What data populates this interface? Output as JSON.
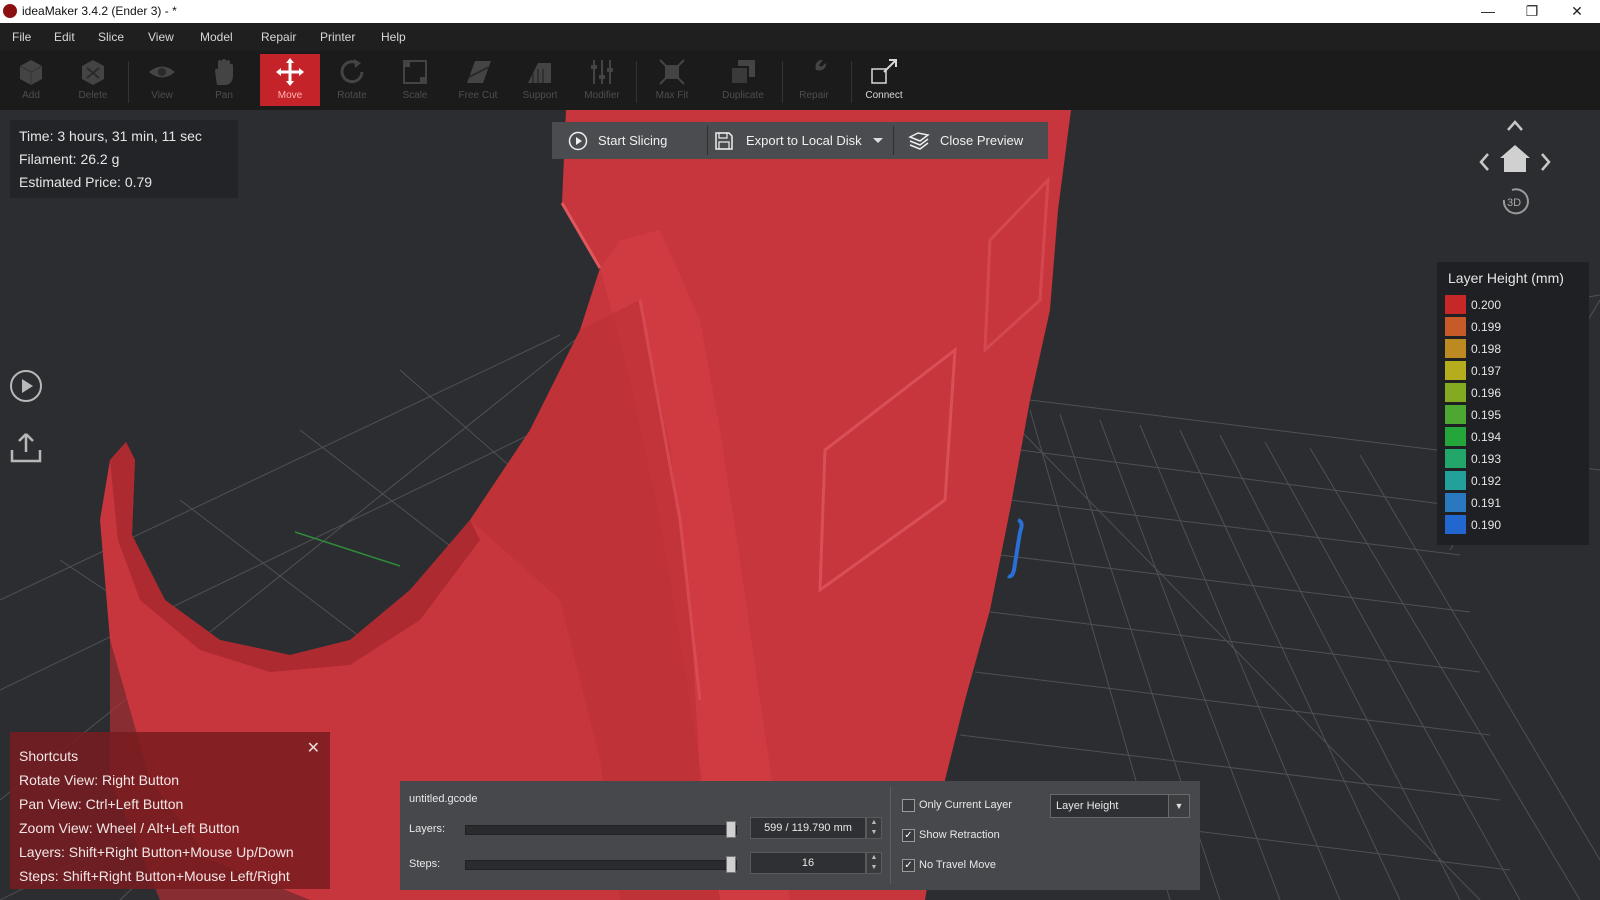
{
  "window": {
    "title": "ideaMaker 3.4.2 (Ender 3) - *",
    "minimize_glyph": "—",
    "maximize_glyph": "❐",
    "close_glyph": "✕"
  },
  "menu": [
    "File",
    "Edit",
    "Slice",
    "View",
    "Model",
    "Repair",
    "Printer",
    "Help"
  ],
  "toolbar": {
    "tools": [
      {
        "label": "Add",
        "icon": "add-cube-icon",
        "state": "disabled"
      },
      {
        "label": "Delete",
        "icon": "delete-cube-icon",
        "state": "disabled"
      },
      {
        "label": "View",
        "icon": "eye-icon",
        "state": "disabled"
      },
      {
        "label": "Pan",
        "icon": "hand-icon",
        "state": "disabled"
      },
      {
        "label": "Move",
        "icon": "move-arrows-icon",
        "state": "active"
      },
      {
        "label": "Rotate",
        "icon": "rotate-icon",
        "state": "disabled"
      },
      {
        "label": "Scale",
        "icon": "scale-icon",
        "state": "disabled"
      },
      {
        "label": "Free Cut",
        "icon": "cut-icon",
        "state": "disabled"
      },
      {
        "label": "Support",
        "icon": "support-icon",
        "state": "disabled"
      },
      {
        "label": "Modifier",
        "icon": "modifier-icon",
        "state": "disabled"
      },
      {
        "label": "Max Fit",
        "icon": "max-fit-icon",
        "state": "disabled"
      },
      {
        "label": "Duplicate",
        "icon": "duplicate-icon",
        "state": "disabled"
      },
      {
        "label": "Repair",
        "icon": "repair-wrench-icon",
        "state": "disabled"
      },
      {
        "label": "Connect",
        "icon": "connect-icon",
        "state": "enabled"
      }
    ]
  },
  "stats": {
    "time": "Time: 3 hours, 31 min, 11 sec",
    "filament": "Filament: 26.2 g",
    "price": "Estimated Price: 0.79"
  },
  "slice_bar": {
    "start": "Start Slicing",
    "export": "Export to Local Disk",
    "close": "Close Preview"
  },
  "nav": {
    "view3d": "3D"
  },
  "legend": {
    "title": "Layer Height (mm)",
    "items": [
      {
        "value": "0.200",
        "color": "#c62828"
      },
      {
        "value": "0.199",
        "color": "#c65a28"
      },
      {
        "value": "0.198",
        "color": "#bd8a22"
      },
      {
        "value": "0.197",
        "color": "#b5ac1e"
      },
      {
        "value": "0.196",
        "color": "#84aa22"
      },
      {
        "value": "0.195",
        "color": "#4ca830"
      },
      {
        "value": "0.194",
        "color": "#24a63a"
      },
      {
        "value": "0.193",
        "color": "#22a66a"
      },
      {
        "value": "0.192",
        "color": "#22a09a"
      },
      {
        "value": "0.191",
        "color": "#2a78c0"
      },
      {
        "value": "0.190",
        "color": "#2266d0"
      }
    ]
  },
  "shortcuts": {
    "title": "Shortcuts",
    "close_glyph": "✕",
    "lines": [
      "Rotate View: Right Button",
      "Pan View: Ctrl+Left Button",
      "Zoom View: Wheel / Alt+Left Button",
      "Layers: Shift+Right Button+Mouse Up/Down",
      "Steps: Shift+Right Button+Mouse Left/Right"
    ]
  },
  "preview": {
    "filename": "untitled.gcode",
    "layers_label": "Layers:",
    "layers_value": "599 / 119.790 mm",
    "layers_fraction": 1.0,
    "steps_label": "Steps:",
    "steps_value": "16",
    "steps_fraction": 1.0,
    "spin_up": "▲",
    "spin_down": "▼",
    "checks": [
      {
        "label": "Only Current Layer",
        "checked": false
      },
      {
        "label": "Show Retraction",
        "checked": true
      },
      {
        "label": "No Travel Move",
        "checked": true
      }
    ],
    "mode": "Layer Height",
    "mode_drop": "▼"
  },
  "colors": {
    "model_red": "#c7363c",
    "accent_red": "#c4232a",
    "travel_blue": "#2a6fd6",
    "grid": "#6c6e72",
    "viewport_bg": "#2b2d30"
  }
}
